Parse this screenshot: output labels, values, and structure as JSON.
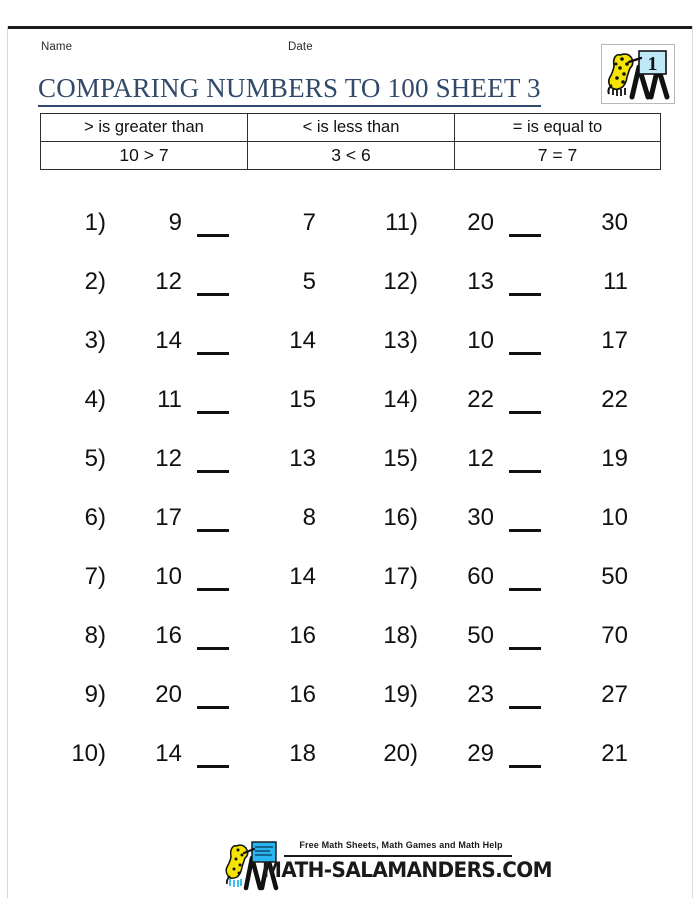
{
  "header": {
    "name_label": "Name",
    "date_label": "Date",
    "title": "COMPARING NUMBERS TO 100 SHEET 3",
    "title_color": "#31496b",
    "logo_grade": "1"
  },
  "legend": {
    "definitions": [
      "> is greater than",
      "< is less than",
      "= is equal to"
    ],
    "examples": [
      "10 > 7",
      "3 < 6",
      "7 = 7"
    ]
  },
  "problems": [
    {
      "num": "1)",
      "left": "9",
      "right": "7"
    },
    {
      "num": "2)",
      "left": "12",
      "right": "5"
    },
    {
      "num": "3)",
      "left": "14",
      "right": "14"
    },
    {
      "num": "4)",
      "left": "11",
      "right": "15"
    },
    {
      "num": "5)",
      "left": "12",
      "right": "13"
    },
    {
      "num": "6)",
      "left": "17",
      "right": "8"
    },
    {
      "num": "7)",
      "left": "10",
      "right": "14"
    },
    {
      "num": "8)",
      "left": "16",
      "right": "16"
    },
    {
      "num": "9)",
      "left": "20",
      "right": "16"
    },
    {
      "num": "10)",
      "left": "14",
      "right": "18"
    },
    {
      "num": "11)",
      "left": "20",
      "right": "30"
    },
    {
      "num": "12)",
      "left": "13",
      "right": "11"
    },
    {
      "num": "13)",
      "left": "10",
      "right": "17"
    },
    {
      "num": "14)",
      "left": "22",
      "right": "22"
    },
    {
      "num": "15)",
      "left": "12",
      "right": "19"
    },
    {
      "num": "16)",
      "left": "30",
      "right": "10"
    },
    {
      "num": "17)",
      "left": "60",
      "right": "50"
    },
    {
      "num": "18)",
      "left": "50",
      "right": "70"
    },
    {
      "num": "19)",
      "left": "23",
      "right": "27"
    },
    {
      "num": "20)",
      "left": "29",
      "right": "21"
    }
  ],
  "footer": {
    "tagline": "Free Math Sheets, Math Games and Math Help",
    "brand": "MATH-SALAMANDERS.COM"
  },
  "colors": {
    "salamander_body": "#f5e400",
    "salamander_spots": "#111111",
    "easel_board": "#bfe9f7",
    "rule": "#1b1b1b"
  }
}
